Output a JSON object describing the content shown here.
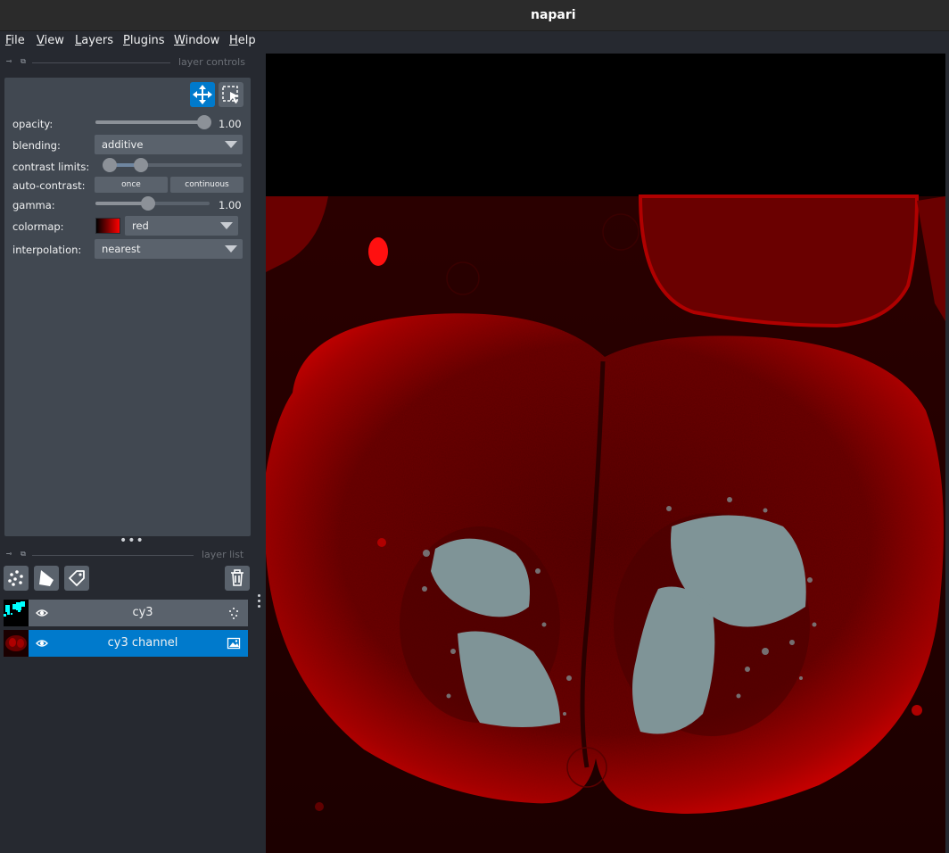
{
  "window": {
    "title": "napari"
  },
  "menu": [
    "File",
    "View",
    "Layers",
    "Plugins",
    "Window",
    "Help"
  ],
  "layer_controls": {
    "dock_title": "layer controls",
    "opacity": {
      "label": "opacity:",
      "value": "1.00",
      "level": 1.0
    },
    "blending": {
      "label": "blending:",
      "value": "additive"
    },
    "contrast_limits": {
      "label": "contrast limits:",
      "low": 0.0,
      "high": 0.25
    },
    "auto_contrast": {
      "label": "auto-contrast:",
      "once": "once",
      "continuous": "continuous"
    },
    "gamma": {
      "label": "gamma:",
      "value": "1.00",
      "level": 0.45
    },
    "colormap": {
      "label": "colormap:",
      "value": "red",
      "color": "#ff0000"
    },
    "interpolation": {
      "label": "interpolation:",
      "value": "nearest"
    },
    "icons": {
      "move": "move-arrows-icon",
      "select": "transform-select-icon"
    }
  },
  "layer_list": {
    "dock_title": "layer list",
    "tools": [
      "new-points-icon",
      "new-shapes-icon",
      "new-labels-icon"
    ],
    "delete": "trash-icon",
    "layers": [
      {
        "name": "cy3",
        "type": "points",
        "selected": false,
        "visible": true
      },
      {
        "name": "cy3 channel",
        "type": "image",
        "selected": true,
        "visible": true
      }
    ]
  },
  "colors": {
    "accent": "#007acc",
    "background": "#262930",
    "panel": "#414851",
    "image_red": "#ff0000",
    "points_cyan": "#00ffff",
    "points_gray": "#7f9497"
  }
}
